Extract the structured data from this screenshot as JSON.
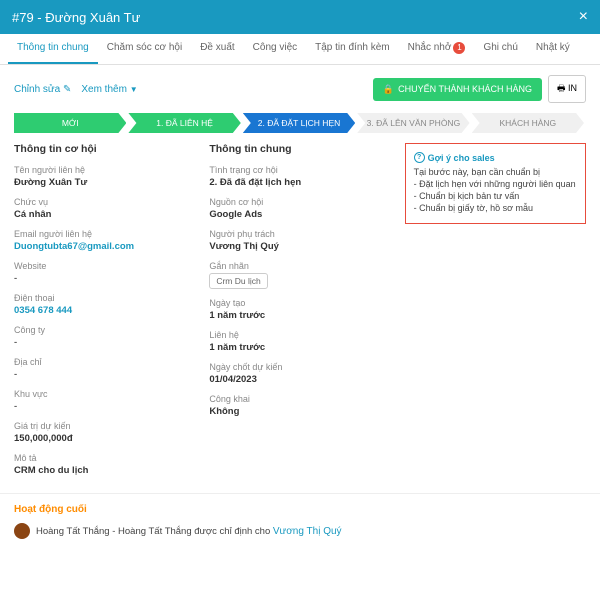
{
  "header": {
    "title": "#79 - Đường Xuân Tư",
    "close": "×"
  },
  "tabs": [
    {
      "label": "Thông tin chung",
      "active": true
    },
    {
      "label": "Chăm sóc cơ hội"
    },
    {
      "label": "Đề xuất"
    },
    {
      "label": "Công việc"
    },
    {
      "label": "Tập tin đính kèm"
    },
    {
      "label": "Nhắc nhở",
      "badge": "1"
    },
    {
      "label": "Ghi chú"
    },
    {
      "label": "Nhật ký"
    }
  ],
  "toolbar": {
    "edit": "Chỉnh sửa",
    "more": "Xem thêm",
    "convert": "CHUYỂN THÀNH KHÁCH HÀNG",
    "print": "IN"
  },
  "stages": [
    {
      "label": "MỚI",
      "cls": ""
    },
    {
      "label": "1. ĐÃ LIÊN HỆ",
      "cls": ""
    },
    {
      "label": "2.    ĐÃ ĐẶT LỊCH HẸN",
      "cls": "blue"
    },
    {
      "label": "3. ĐÃ LÊN VĂN PHÒNG",
      "cls": "gray"
    },
    {
      "label": "KHÁCH HÀNG",
      "cls": "gray"
    }
  ],
  "col1": {
    "title": "Thông tin cơ hội",
    "fields": [
      {
        "l": "Tên người liên hệ",
        "v": "Đường Xuân Tư"
      },
      {
        "l": "Chức vụ",
        "v": "Cá nhân"
      },
      {
        "l": "Email người liên hệ",
        "v": "Duongtubta67@gmail.com",
        "link": true
      },
      {
        "l": "Website",
        "v": "-"
      },
      {
        "l": "Điện thoại",
        "v": "0354 678 444",
        "link": true
      },
      {
        "l": "Công ty",
        "v": "-"
      },
      {
        "l": "Địa chỉ",
        "v": "-"
      },
      {
        "l": "Khu vực",
        "v": "-"
      },
      {
        "l": "Giá trị dự kiến",
        "v": "150,000,000đ"
      },
      {
        "l": "Mô tả",
        "v": "CRM cho du lịch"
      }
    ]
  },
  "col2": {
    "title": "Thông tin chung",
    "fields": [
      {
        "l": "Tình trạng cơ hội",
        "v": "2. Đã đã đặt lịch hẹn"
      },
      {
        "l": "Nguồn cơ hội",
        "v": "Google Ads"
      },
      {
        "l": "Người phụ trách",
        "v": "Vương Thị Quý"
      },
      {
        "l": "Gắn nhãn",
        "tag": "Crm Du lịch"
      },
      {
        "l": "Ngày tạo",
        "v": "1 năm trước"
      },
      {
        "l": "Liên hệ",
        "v": "1 năm trước"
      },
      {
        "l": "Ngày chốt dự kiến",
        "v": "01/04/2023"
      },
      {
        "l": "Công khai",
        "v": "Không"
      }
    ]
  },
  "sales": {
    "title": "Gợi ý cho sales",
    "lines": [
      "Tại bước này, bạn cần chuẩn bị",
      "- Đặt lịch hẹn với những người liên quan",
      "- Chuẩn bị kịch bản tư vấn",
      "- Chuẩn bị giấy tờ, hồ sơ mẫu"
    ]
  },
  "activity": {
    "title": "Hoạt động cuối",
    "text_a": "Hoàng Tất Thắng - Hoàng Tất Thắng được chỉ định cho ",
    "text_b": "Vương Thị Quý"
  }
}
